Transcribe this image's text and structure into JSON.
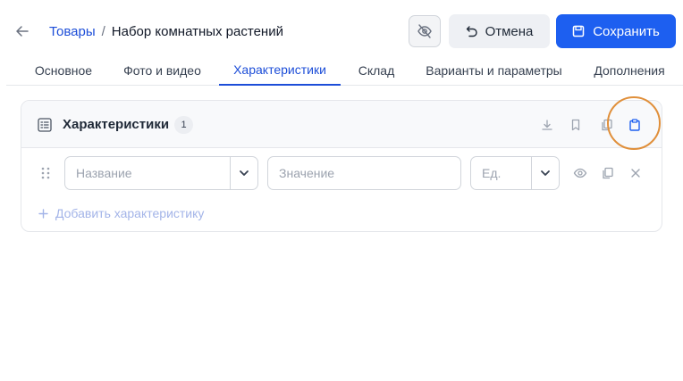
{
  "breadcrumb": {
    "parent": "Товары",
    "separator": "/",
    "current": "Набор комнатных растений"
  },
  "header": {
    "cancel_label": "Отмена",
    "save_label": "Сохранить"
  },
  "tabs": [
    {
      "label": "Основное"
    },
    {
      "label": "Фото и видео"
    },
    {
      "label": "Характеристики",
      "active": true
    },
    {
      "label": "Склад"
    },
    {
      "label": "Варианты и параметры"
    },
    {
      "label": "Дополнения"
    }
  ],
  "section": {
    "title": "Характеристики",
    "count": "1"
  },
  "row": {
    "name_placeholder": "Название",
    "value_placeholder": "Значение",
    "unit_placeholder": "Ед."
  },
  "add_label": "Добавить характеристику",
  "colors": {
    "primary": "#1d5ff0",
    "link": "#1d4ed8",
    "highlight": "#e08f3a",
    "muted": "#a3b4e8"
  },
  "icons": [
    "arrow-left-icon",
    "eye-off-icon",
    "undo-icon",
    "save-icon",
    "list-icon",
    "download-icon",
    "bookmark-icon",
    "copy-icon",
    "clipboard-icon",
    "drag-icon",
    "chevron-down-icon",
    "eye-icon",
    "close-icon",
    "plus-icon"
  ]
}
